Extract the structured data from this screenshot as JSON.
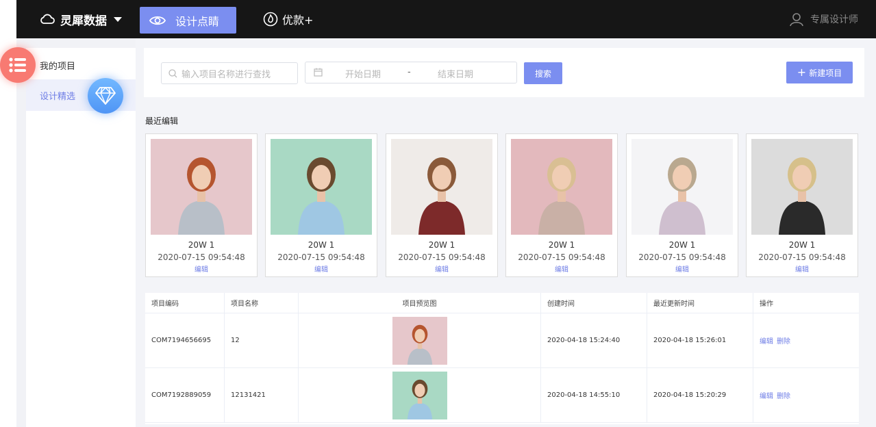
{
  "topbar": {
    "brand": "灵犀数据",
    "active_nav": "设计点睛",
    "nav_item": "优款+",
    "user": "专属设计师",
    "background": "#161616",
    "accent": "#7b8ef0"
  },
  "sidebar": {
    "items": [
      {
        "label": "我的项目",
        "icon": "list-icon"
      },
      {
        "label": "设计精选",
        "icon": "diamond-icon"
      }
    ],
    "active_color": "#6f7ee6"
  },
  "search": {
    "placeholder": "输入项目名称进行查找",
    "start_placeholder": "开始日期",
    "separator": "-",
    "end_placeholder": "结束日期",
    "search_label": "搜索",
    "new_label": "新建项目"
  },
  "recent": {
    "title": "最近编辑",
    "cards": [
      {
        "title": "20W 1",
        "time": "2020-07-15 09:54:48",
        "edit": "编辑",
        "bg": "#e6c7cb",
        "hair": "#b5552f",
        "top": "#b8bfc8"
      },
      {
        "title": "20W 1",
        "time": "2020-07-15 09:54:48",
        "edit": "编辑",
        "bg": "#a9d9c4",
        "hair": "#6a4a2f",
        "top": "#9fc7e3"
      },
      {
        "title": "20W 1",
        "time": "2020-07-15 09:54:48",
        "edit": "编辑",
        "bg": "#efebe8",
        "hair": "#8a5a3a",
        "top": "#7d2a2a"
      },
      {
        "title": "20W 1",
        "time": "2020-07-15 09:54:48",
        "edit": "编辑",
        "bg": "#e3b9bd",
        "hair": "#d9bf93",
        "top": "#c9b0a6"
      },
      {
        "title": "20W 1",
        "time": "2020-07-15 09:54:48",
        "edit": "编辑",
        "bg": "#f4f4f6",
        "hair": "#b9a88f",
        "top": "#cfbfcf"
      },
      {
        "title": "20W 1",
        "time": "2020-07-15 09:54:48",
        "edit": "编辑",
        "bg": "#dcdcdc",
        "hair": "#d6c08a",
        "top": "#2a2a2a"
      }
    ]
  },
  "table": {
    "headers": [
      "项目编码",
      "项目名称",
      "项目预览图",
      "创建时间",
      "最近更新时间",
      "操作"
    ],
    "rows": [
      {
        "code": "COM7194656695",
        "name": "12",
        "created": "2020-04-18 15:24:40",
        "updated": "2020-04-18 15:26:01",
        "edit": "编辑",
        "delete": "删除"
      },
      {
        "code": "COM7192889059",
        "name": "12131421",
        "created": "2020-04-18 14:55:10",
        "updated": "2020-04-18 15:20:29",
        "edit": "编辑",
        "delete": "删除"
      }
    ]
  }
}
